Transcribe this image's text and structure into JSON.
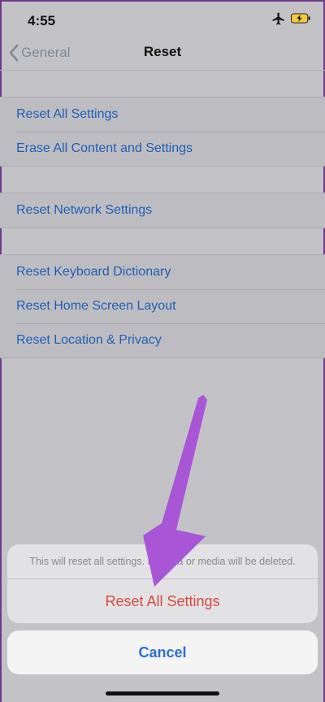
{
  "status_bar": {
    "time": "4:55",
    "icons": [
      "airplane-icon",
      "battery-charging-icon"
    ]
  },
  "nav": {
    "back_label": "General",
    "title": "Reset"
  },
  "groups": [
    {
      "rows": [
        {
          "label": "Reset All Settings"
        },
        {
          "label": "Erase All Content and Settings"
        }
      ]
    },
    {
      "rows": [
        {
          "label": "Reset Network Settings"
        }
      ]
    },
    {
      "rows": [
        {
          "label": "Reset Keyboard Dictionary"
        },
        {
          "label": "Reset Home Screen Layout"
        },
        {
          "label": "Reset Location & Privacy"
        }
      ]
    }
  ],
  "action_sheet": {
    "message": "This will reset all settings. No data or media will be deleted.",
    "destructive_label": "Reset All Settings",
    "cancel_label": "Cancel"
  },
  "colors": {
    "link_blue": "#1f5fb8",
    "destructive_red": "#d64a3e",
    "annotation_arrow": "#a855d6"
  }
}
